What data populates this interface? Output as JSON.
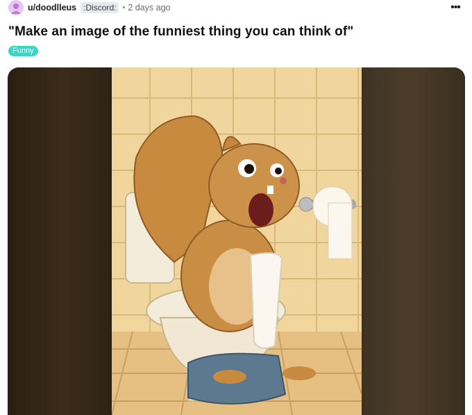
{
  "post": {
    "username": "u/doodlleus",
    "user_flair": ":Discord:",
    "separator": "•",
    "timestamp": "2 days ago",
    "more_label": "•••",
    "title": "\"Make an image of the funniest thing you can think of\"",
    "post_flair": "Funny"
  },
  "colors": {
    "post_flair_bg": "#3fd3c1",
    "avatar_bg": "#e8c6f2",
    "user_flair_bg": "#e7e9ec"
  },
  "icons": [
    "avatar-icon",
    "more-options-icon"
  ]
}
